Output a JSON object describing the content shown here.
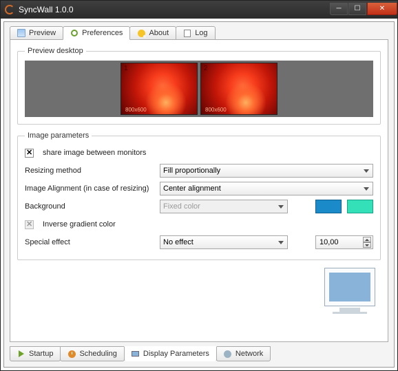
{
  "window": {
    "title": "SyncWall 1.0.0"
  },
  "top_tabs": [
    {
      "label": "Preview"
    },
    {
      "label": "Preferences"
    },
    {
      "label": "About"
    },
    {
      "label": "Log"
    }
  ],
  "preview_group": {
    "legend": "Preview  desktop",
    "monitors": [
      {
        "index": "1",
        "res": "800x600"
      },
      {
        "index": "2",
        "res": "800x600"
      }
    ]
  },
  "params": {
    "legend": "Image parameters",
    "share_label": "share image between monitors",
    "resizing_label": "Resizing method",
    "resizing_value": "Fill proportionally",
    "alignment_label": "Image Alignment (in case of resizing)",
    "alignment_value": "Center alignment",
    "background_label": "Background",
    "background_value": "Fixed color",
    "inverse_label": "Inverse gradient color",
    "effect_label": "Special effect",
    "effect_value": "No effect",
    "spin_value": "10,00",
    "swatch1": "#1a8ac8",
    "swatch2": "#34e0b8"
  },
  "bottom_tabs": [
    {
      "label": "Startup"
    },
    {
      "label": "Scheduling"
    },
    {
      "label": "Display Parameters"
    },
    {
      "label": "Network"
    }
  ]
}
